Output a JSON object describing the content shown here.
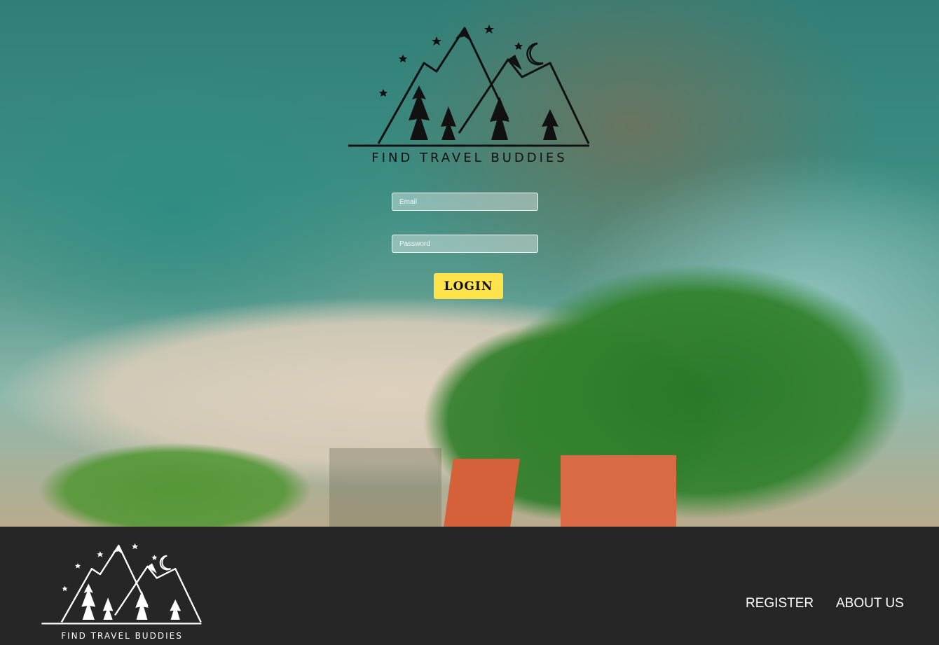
{
  "brand": {
    "name": "FIND TRAVEL BUDDIES"
  },
  "login_form": {
    "email_placeholder": "Email",
    "password_placeholder": "Password",
    "login_label": "LOGIN",
    "login_color": "#ffe34a"
  },
  "footer": {
    "background": "#262626",
    "nav": {
      "register_label": "REGISTER",
      "about_label": "ABOUT US"
    }
  }
}
